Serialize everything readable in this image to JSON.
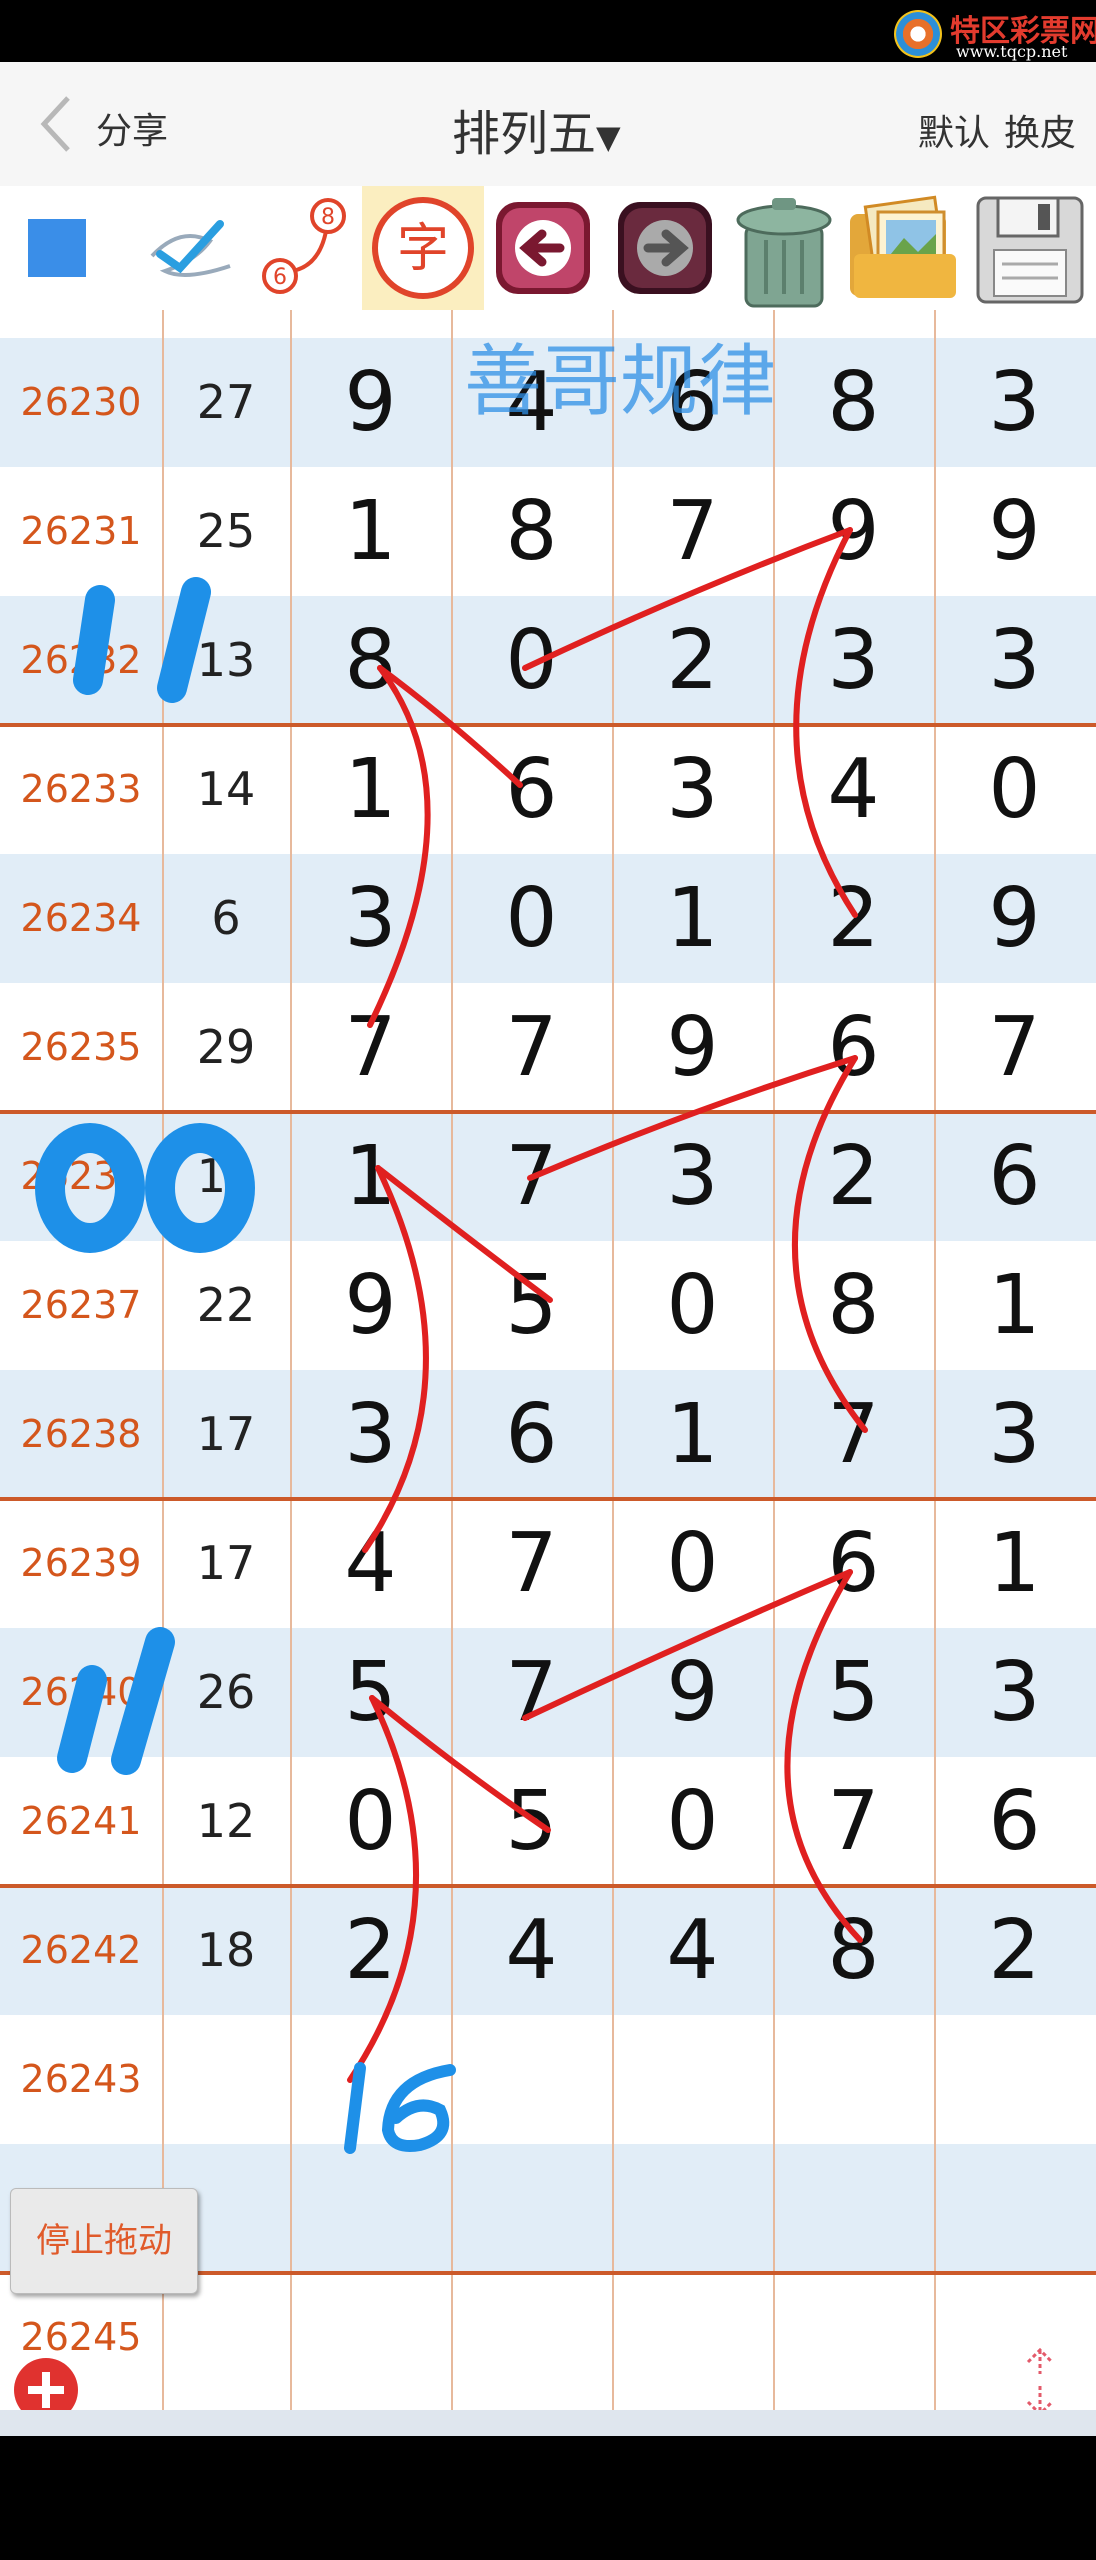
{
  "watermark": {
    "title": "特区彩票网",
    "url": "www.tqcp.net"
  },
  "nav": {
    "back_label": "分享",
    "title": "排列五",
    "links": [
      "默认",
      "换皮"
    ]
  },
  "toolbar": {
    "items": [
      {
        "name": "square-tool-icon"
      },
      {
        "name": "pen-tool-icon"
      },
      {
        "name": "connect-tool-icon",
        "label_a": "8",
        "label_b": "6"
      },
      {
        "name": "text-tool-icon",
        "glyph": "字"
      },
      {
        "name": "undo-icon"
      },
      {
        "name": "redo-icon"
      },
      {
        "name": "trash-icon"
      },
      {
        "name": "gallery-icon"
      },
      {
        "name": "save-icon"
      }
    ]
  },
  "annotation_title": "善哥规律",
  "rows": [
    {
      "issue": "26230",
      "sum": "27",
      "digits": [
        "9",
        "4",
        "6",
        "8",
        "3"
      ]
    },
    {
      "issue": "26231",
      "sum": "25",
      "digits": [
        "1",
        "8",
        "7",
        "9",
        "9"
      ]
    },
    {
      "issue": "26232",
      "sum": "13",
      "digits": [
        "8",
        "0",
        "2",
        "3",
        "3"
      ]
    },
    {
      "issue": "26233",
      "sum": "14",
      "digits": [
        "1",
        "6",
        "3",
        "4",
        "0"
      ]
    },
    {
      "issue": "26234",
      "sum": "6",
      "digits": [
        "3",
        "0",
        "1",
        "2",
        "9"
      ]
    },
    {
      "issue": "26235",
      "sum": "29",
      "digits": [
        "7",
        "7",
        "9",
        "6",
        "7"
      ]
    },
    {
      "issue": "26236",
      "sum": "19",
      "digits": [
        "1",
        "7",
        "3",
        "2",
        "6"
      ]
    },
    {
      "issue": "26237",
      "sum": "22",
      "digits": [
        "9",
        "5",
        "0",
        "8",
        "1"
      ]
    },
    {
      "issue": "26238",
      "sum": "17",
      "digits": [
        "3",
        "6",
        "1",
        "7",
        "3"
      ]
    },
    {
      "issue": "26239",
      "sum": "17",
      "digits": [
        "4",
        "7",
        "0",
        "6",
        "1"
      ]
    },
    {
      "issue": "26240",
      "sum": "26",
      "digits": [
        "5",
        "7",
        "9",
        "5",
        "3"
      ]
    },
    {
      "issue": "26241",
      "sum": "12",
      "digits": [
        "0",
        "5",
        "0",
        "7",
        "6"
      ]
    },
    {
      "issue": "26242",
      "sum": "18",
      "digits": [
        "2",
        "4",
        "4",
        "8",
        "2"
      ]
    },
    {
      "issue": "26243",
      "sum": "",
      "digits": [
        "",
        "",
        "",
        "",
        ""
      ]
    },
    {
      "issue": "",
      "sum": "",
      "digits": [
        "",
        "",
        "",
        "",
        ""
      ]
    },
    {
      "issue": "26245",
      "sum": "",
      "digits": [
        "",
        "",
        "",
        "",
        ""
      ]
    }
  ],
  "handwriting": {
    "marks": [
      "11",
      "00",
      "11",
      "16"
    ]
  },
  "buttons": {
    "stop_drag": "停止拖动"
  },
  "colors": {
    "issue": "#d4561c",
    "separator": "#cc5a2a",
    "stripe": "#e1edf7",
    "pen_red": "#e02020",
    "pen_blue": "#1e90e8"
  }
}
